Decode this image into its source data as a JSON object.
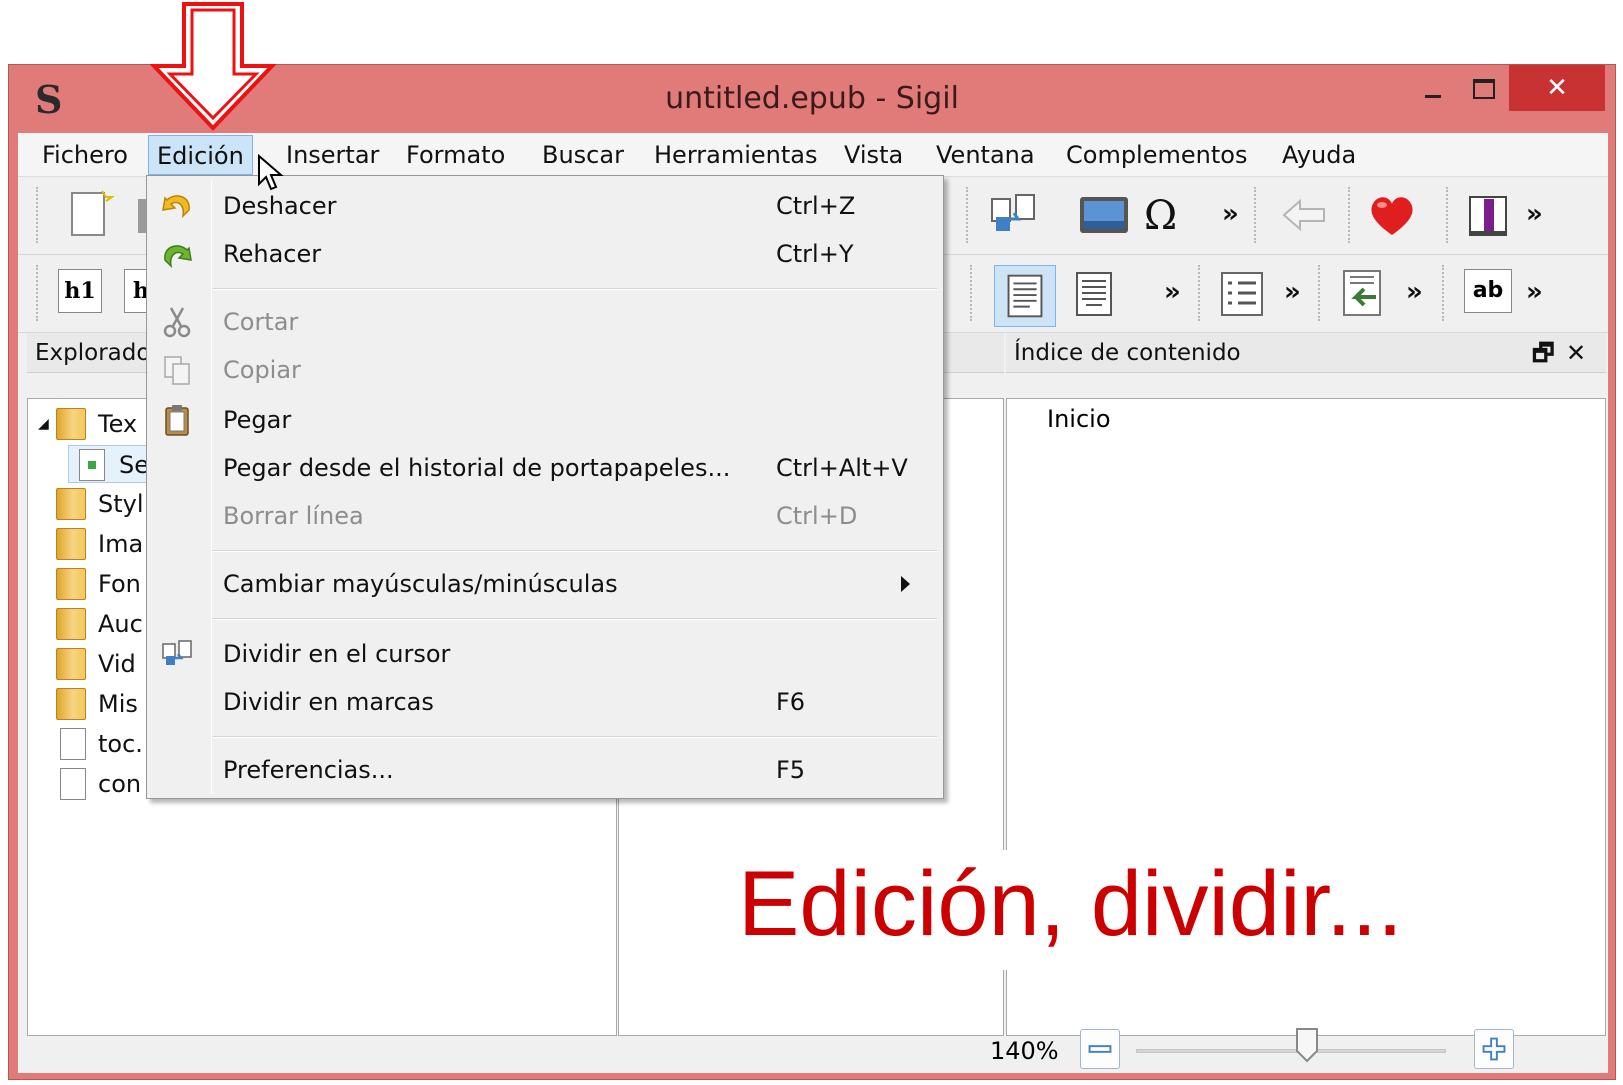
{
  "window": {
    "title": "untitled.epub - Sigil",
    "app_logo": "S",
    "close_glyph": "✕"
  },
  "menubar": {
    "items": [
      "Fichero",
      "Edición",
      "Insertar",
      "Formato",
      "Buscar",
      "Herramientas",
      "Vista",
      "Ventana",
      "Complementos",
      "Ayuda"
    ]
  },
  "toolbar": {
    "row1_icons": [
      "new-file-icon",
      "open-folder-icon",
      "split-icon",
      "insert-image-icon",
      "omega-icon",
      "back-arrow-icon",
      "heart-icon",
      "info-icon"
    ],
    "row2_icons": [
      "h1-icon",
      "h2-icon",
      "align-left-icon",
      "align-center-icon",
      "list-icon",
      "indent-icon",
      "ab-icon"
    ],
    "h1_text": "h1",
    "h2_text": "h",
    "ab_text": "ab",
    "omega_text": "Ω",
    "overflow": "»"
  },
  "explorer": {
    "title": "Explorador",
    "items": [
      {
        "label": "Tex",
        "type": "folder",
        "expanded": true
      },
      {
        "label": "Se",
        "type": "html"
      },
      {
        "label": "Styl",
        "type": "folder"
      },
      {
        "label": "Ima",
        "type": "folder"
      },
      {
        "label": "Fon",
        "type": "folder"
      },
      {
        "label": "Auc",
        "type": "folder"
      },
      {
        "label": "Vid",
        "type": "folder"
      },
      {
        "label": "Mis",
        "type": "folder"
      },
      {
        "label": "toc.",
        "type": "file"
      },
      {
        "label": "con",
        "type": "file"
      }
    ]
  },
  "toc": {
    "title": "Índice de contenido",
    "entry": "Inicio",
    "float_glyph": "🗗",
    "close_glyph": "✕"
  },
  "edit_menu": {
    "items": [
      {
        "label": "Deshacer",
        "shortcut": "Ctrl+Z",
        "icon": "undo-icon",
        "enabled": true
      },
      {
        "label": "Rehacer",
        "shortcut": "Ctrl+Y",
        "icon": "redo-icon",
        "enabled": true
      },
      {
        "label": "Cortar",
        "shortcut": "",
        "icon": "scissors-icon",
        "enabled": false
      },
      {
        "label": "Copiar",
        "shortcut": "",
        "icon": "copy-icon",
        "enabled": false
      },
      {
        "label": "Pegar",
        "shortcut": "",
        "icon": "paste-icon",
        "enabled": true
      },
      {
        "label": "Pegar desde el historial de portapapeles...",
        "shortcut": "Ctrl+Alt+V",
        "icon": "",
        "enabled": true
      },
      {
        "label": "Borrar línea",
        "shortcut": "Ctrl+D",
        "icon": "",
        "enabled": false
      },
      {
        "label": "Cambiar mayúsculas/minúsculas",
        "shortcut": "",
        "icon": "",
        "enabled": true,
        "submenu": true
      },
      {
        "label": "Dividir en el cursor",
        "shortcut": "",
        "icon": "split-icon",
        "enabled": true
      },
      {
        "label": "Dividir en marcas",
        "shortcut": "F6",
        "icon": "",
        "enabled": true
      },
      {
        "label": "Preferencias...",
        "shortcut": "F5",
        "icon": "",
        "enabled": true
      }
    ]
  },
  "statusbar": {
    "zoom": "140%",
    "zoom_level_fraction": 0.55
  },
  "annotation": {
    "text": "Edición, dividir..."
  },
  "colors": {
    "window_frame": "#e07b79",
    "close_button": "#c83232",
    "annotation_red": "#cc0000",
    "menu_open": "#cce4f7"
  }
}
